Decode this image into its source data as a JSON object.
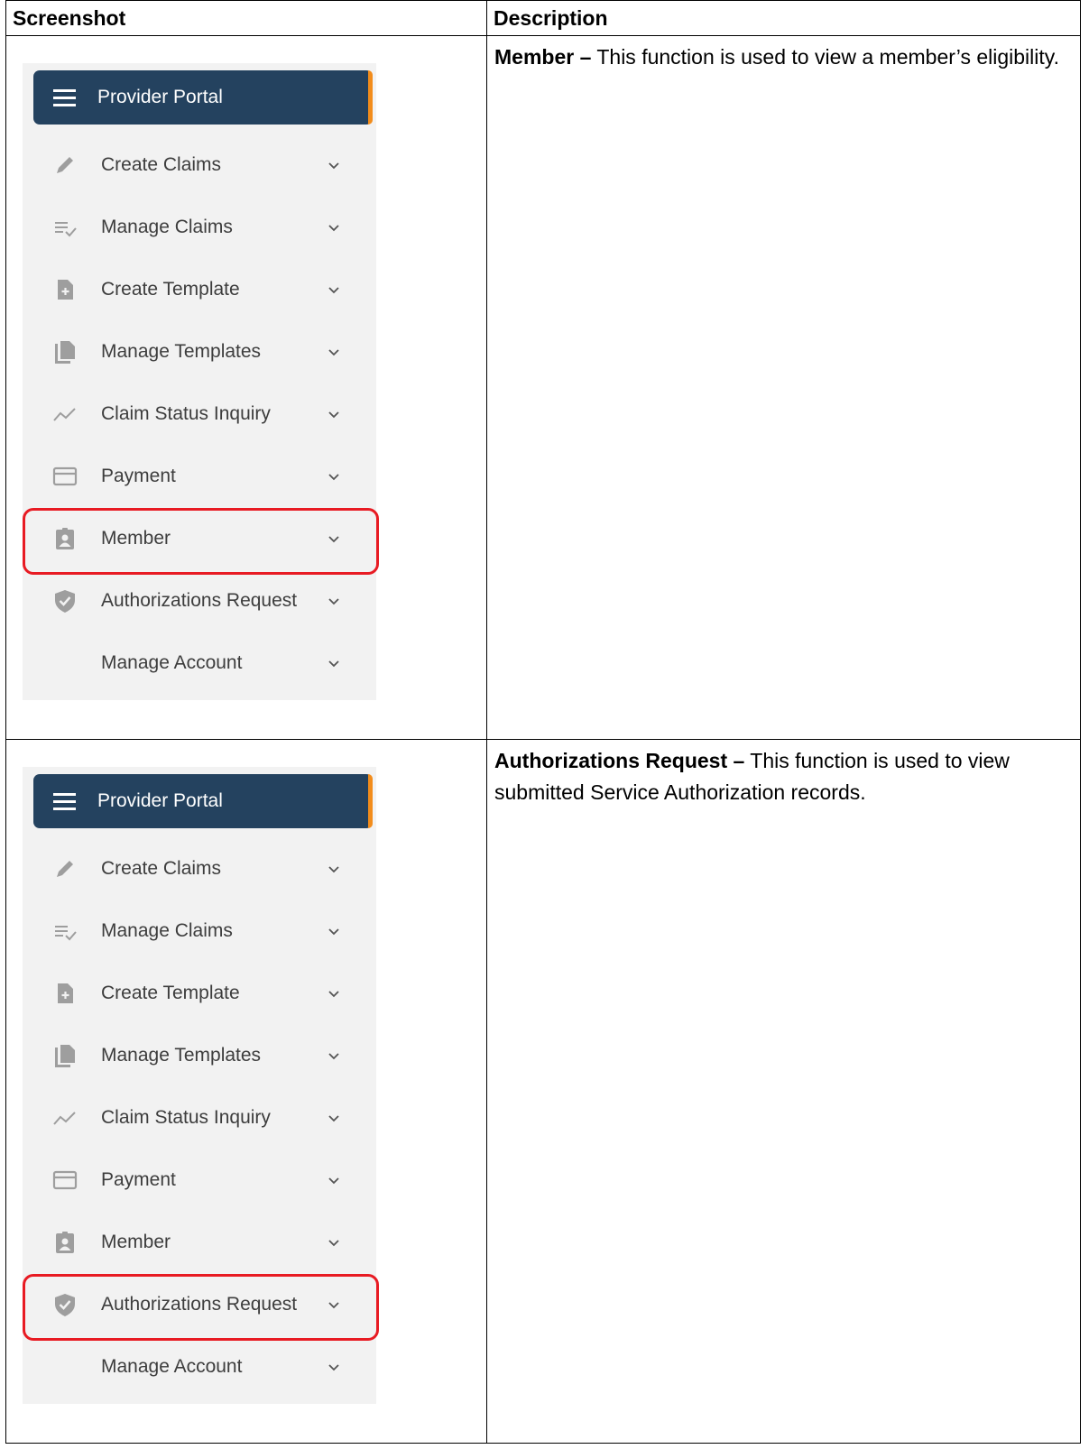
{
  "table": {
    "headers": {
      "screenshot": "Screenshot",
      "description": "Description"
    },
    "rows": [
      {
        "title": "Member –",
        "text": " This function is used to view a member’s eligibility.",
        "highlighted_item": "Member"
      },
      {
        "title": "Authorizations Request –",
        "text": " This function is used to view submitted Service Authorization records.",
        "highlighted_item": "Authorizations Request"
      }
    ]
  },
  "portal": {
    "title": "Provider Portal",
    "items": [
      {
        "label": "Create Claims",
        "icon": "pencil-icon"
      },
      {
        "label": "Manage Claims",
        "icon": "list-check-icon"
      },
      {
        "label": "Create Template",
        "icon": "file-add-icon"
      },
      {
        "label": "Manage Templates",
        "icon": "files-icon"
      },
      {
        "label": "Claim Status Inquiry",
        "icon": "trend-icon"
      },
      {
        "label": "Payment",
        "icon": "card-icon"
      },
      {
        "label": "Member",
        "icon": "badge-icon"
      },
      {
        "label": "Authorizations Request",
        "icon": "shield-check-icon"
      },
      {
        "label": "Manage Account",
        "icon": ""
      }
    ]
  },
  "colors": {
    "header": "#24425f",
    "accent": "#f28c1b",
    "highlight": "#e81b23",
    "panel": "#f2f2f2"
  }
}
